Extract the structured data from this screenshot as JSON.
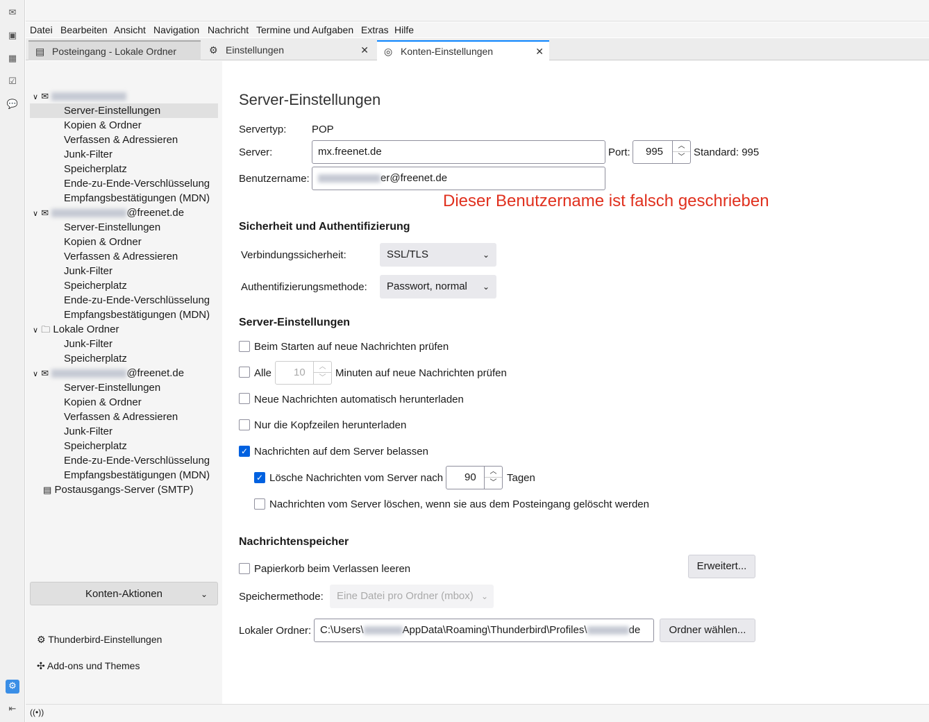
{
  "menu": [
    "Datei",
    "Bearbeiten",
    "Ansicht",
    "Navigation",
    "Nachricht",
    "Termine und Aufgaben",
    "Extras",
    "Hilfe"
  ],
  "tabs": [
    {
      "label": "Posteingang - Lokale Ordner"
    },
    {
      "label": "Einstellungen"
    },
    {
      "label": "Konten-Einstellungen"
    }
  ],
  "sidebar": {
    "accounts": [
      {
        "suffix": "",
        "items": [
          "Server-Einstellungen",
          "Kopien & Ordner",
          "Verfassen & Adressieren",
          "Junk-Filter",
          "Speicherplatz",
          "Ende-zu-Ende-Verschlüsselung",
          "Empfangsbestätigungen (MDN)"
        ]
      },
      {
        "suffix": "@freenet.de",
        "items": [
          "Server-Einstellungen",
          "Kopien & Ordner",
          "Verfassen & Adressieren",
          "Junk-Filter",
          "Speicherplatz",
          "Ende-zu-Ende-Verschlüsselung",
          "Empfangsbestätigungen (MDN)"
        ]
      },
      {
        "suffix": "Lokale Ordner",
        "items": [
          "Junk-Filter",
          "Speicherplatz"
        ]
      },
      {
        "suffix": "@freenet.de",
        "items": [
          "Server-Einstellungen",
          "Kopien & Ordner",
          "Verfassen & Adressieren",
          "Junk-Filter",
          "Speicherplatz",
          "Ende-zu-Ende-Verschlüsselung",
          "Empfangsbestätigungen (MDN)"
        ]
      }
    ],
    "smtp": "Postausgangs-Server (SMTP)",
    "actions": "Konten-Aktionen",
    "tb_settings": "Thunderbird-Einstellungen",
    "addons": "Add-ons und Themes"
  },
  "main": {
    "title": "Server-Einstellungen",
    "servertype_label": "Servertyp:",
    "servertype": "POP",
    "server_label": "Server:",
    "server": "mx.freenet.de",
    "port_label": "Port:",
    "port": "995",
    "standard": "Standard: 995",
    "user_label": "Benutzername:",
    "user_visible": "er@freenet.de",
    "annotation": "Dieser Benutzername ist falsch geschrieben",
    "security_heading": "Sicherheit und Authentifizierung",
    "conn_label": "Verbindungssicherheit:",
    "conn": "SSL/TLS",
    "auth_label": "Authentifizierungsmethode:",
    "auth": "Passwort, normal",
    "server_heading": "Server-Einstellungen",
    "opt1": "Beim Starten auf neue Nachrichten prüfen",
    "opt2a": "Alle",
    "opt2_val": "10",
    "opt2b": "Minuten auf neue Nachrichten prüfen",
    "opt3": "Neue Nachrichten automatisch herunterladen",
    "opt4": "Nur die Kopfzeilen herunterladen",
    "opt5": "Nachrichten auf dem Server belassen",
    "opt6a": "Lösche Nachrichten vom Server nach",
    "opt6_val": "90",
    "opt6b": "Tagen",
    "opt7": "Nachrichten vom Server löschen, wenn sie aus dem Posteingang gelöscht werden",
    "storage_heading": "Nachrichtenspeicher",
    "trash": "Papierkorb beim Verlassen leeren",
    "advanced": "Erweitert...",
    "method_label": "Speichermethode:",
    "method": "Eine Datei pro Ordner (mbox)",
    "local_label": "Lokaler Ordner:",
    "local_a": "C:\\Users\\",
    "local_b": "AppData\\Roaming\\Thunderbird\\Profiles\\",
    "local_c": "de",
    "choose": "Ordner wählen..."
  }
}
